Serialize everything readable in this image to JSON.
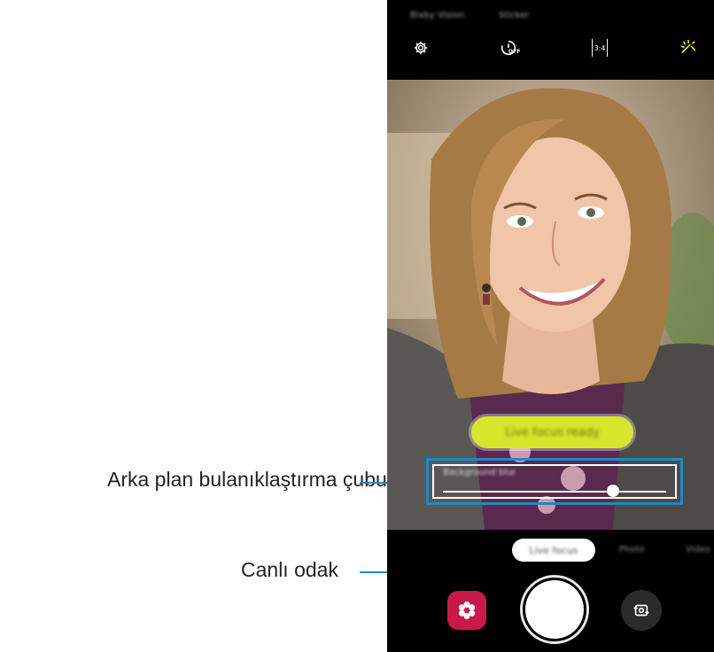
{
  "callouts": {
    "blur_bar_label": "Arka plan bulanıklaştırma çubuğu",
    "live_focus_label": "Canlı odak"
  },
  "camera": {
    "top_modes": [
      "Bixby Vision",
      "Sticker"
    ],
    "top_icons": [
      "gear-icon",
      "timer-off-icon",
      "aspect-ratio-icon",
      "filter-sparkle-icon"
    ],
    "aspect_ratio": "3:4",
    "timer_state": "OFF",
    "status_pill": "Live focus ready",
    "blur_bar_title": "Background blur",
    "blur_level": 0.76,
    "modes": [
      "Live focus",
      "Photo",
      "Video"
    ],
    "selected_mode": "Live focus",
    "bottom_icons": [
      "gallery-flower-icon",
      "shutter-button",
      "switch-camera-icon"
    ],
    "colors": {
      "accent_blue": "#1e88c8",
      "pill_yellow": "#d6e62c",
      "gallery_pink": "#c8194b"
    }
  }
}
